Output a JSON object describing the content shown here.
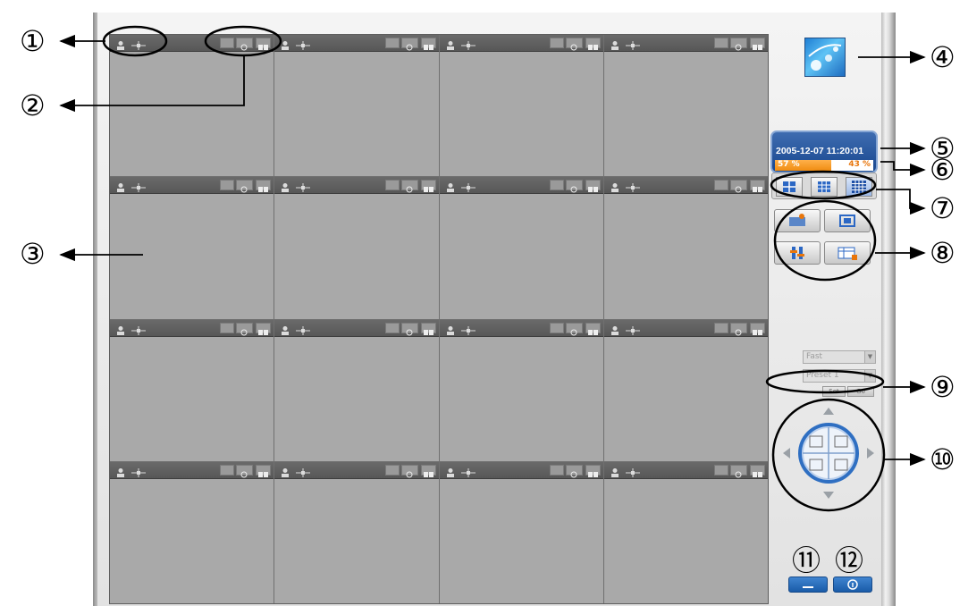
{
  "viewer": {
    "rows": 4,
    "columns": 4,
    "camera_toolbar_icons": [
      "person-icon",
      "ptz-arrows-icon",
      "status-icon",
      "capture-icon",
      "split-view-icon"
    ]
  },
  "side_panel": {
    "logo_icon": "network-logo-icon",
    "datetime": "2005-12-07 11:20:01",
    "hdd_used_label": "57 %",
    "hdd_free_label": "43 %",
    "hdd_used_fraction": 0.57,
    "layout_buttons": [
      "layout-4-icon",
      "layout-9-icon",
      "layout-16-icon"
    ],
    "tool_buttons": [
      "record-icon",
      "fullscreen-icon",
      "settings-icon",
      "playback-icon"
    ],
    "ptz_speed": "Fast",
    "ptz_preset": "Preset 1",
    "set_label": "Set",
    "go_label": "Go",
    "ptz_icons": [
      "zoom-in-icon",
      "zoom-out-icon",
      "focus-near-icon",
      "focus-far-icon"
    ],
    "bottom_buttons": [
      "minimize-icon",
      "info-icon"
    ]
  },
  "callouts": [
    "①",
    "②",
    "③",
    "④",
    "⑤",
    "⑥",
    "⑦",
    "⑧",
    "⑨",
    "⑩",
    "⑪",
    "⑫"
  ],
  "colors": {
    "video_cell": "#a9a9a9",
    "toolbar": "#5f5f5f",
    "clock_blue": "#1c4a92",
    "hdd_orange": "#f08c12",
    "accent_blue": "#2a6fc0"
  }
}
